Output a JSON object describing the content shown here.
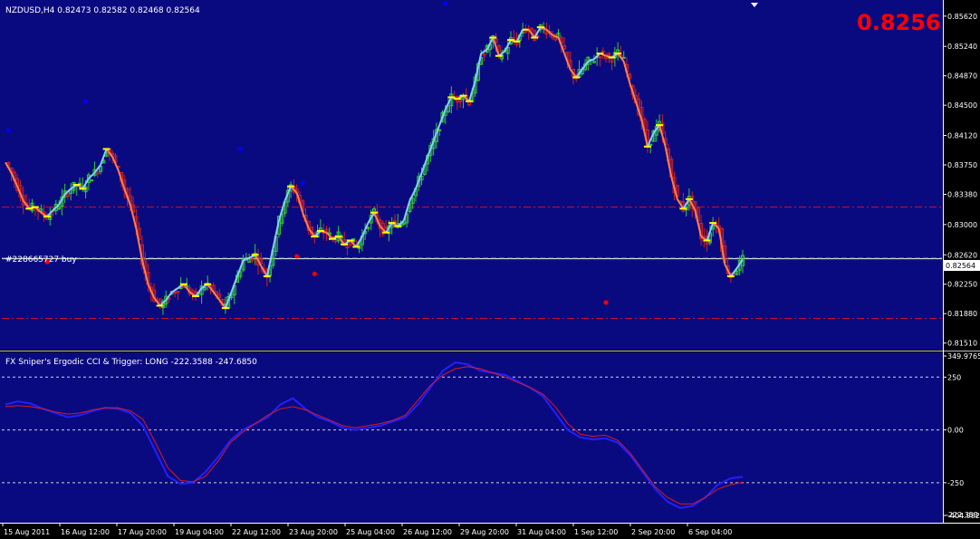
{
  "window": {
    "info_line": "NZDUSD,H4  0.82473 0.82582 0.82468 0.82564",
    "big_price": "0.8256",
    "order_label": "#228665727 buy",
    "bg_color": "#0a0a80",
    "grid_color": "#ffffff"
  },
  "chart_data": [
    {
      "type": "candlestick",
      "title": "NZDUSD,H4",
      "ohlc_last": {
        "open": 0.82473,
        "high": 0.82582,
        "low": 0.82468,
        "close": 0.82564
      },
      "y_ticks": [
        "0.85620",
        "0.85240",
        "0.84870",
        "0.84500",
        "0.84120",
        "0.83750",
        "0.83380",
        "0.83000",
        "0.82620",
        "0.82250",
        "0.81880",
        "0.81510"
      ],
      "y_tick_values": [
        0.8562,
        0.8524,
        0.8487,
        0.845,
        0.8412,
        0.8375,
        0.8338,
        0.83,
        0.8262,
        0.8225,
        0.8188,
        0.8151
      ],
      "ylim": [
        0.8145,
        0.858
      ],
      "current_price_label": "0.82564",
      "current_price": 0.82564,
      "horizontal_lines": [
        {
          "name": "order-line",
          "value": 0.8257,
          "style": "solid",
          "color": "#ffffff"
        },
        {
          "name": "upper-level",
          "value": 0.8322,
          "style": "dashdot",
          "color": "#c8102e"
        },
        {
          "name": "lower-level",
          "value": 0.8182,
          "style": "dashdot",
          "color": "#c8102e"
        },
        {
          "name": "bid-line",
          "value": 0.8258,
          "style": "dashed",
          "color": "#2e8b57"
        }
      ],
      "closes": [
        0.8378,
        0.8365,
        0.8348,
        0.833,
        0.832,
        0.8322,
        0.8315,
        0.831,
        0.8318,
        0.8325,
        0.8338,
        0.8345,
        0.835,
        0.8345,
        0.8358,
        0.8365,
        0.8375,
        0.8395,
        0.8385,
        0.8368,
        0.8345,
        0.8325,
        0.8295,
        0.8255,
        0.8225,
        0.8208,
        0.8198,
        0.8205,
        0.8215,
        0.822,
        0.8225,
        0.8215,
        0.821,
        0.822,
        0.8225,
        0.8215,
        0.8205,
        0.8195,
        0.8215,
        0.8235,
        0.8255,
        0.8258,
        0.8262,
        0.8248,
        0.8235,
        0.827,
        0.8305,
        0.833,
        0.8348,
        0.834,
        0.8315,
        0.8295,
        0.8285,
        0.8292,
        0.829,
        0.8282,
        0.8285,
        0.8275,
        0.828,
        0.8272,
        0.8285,
        0.8302,
        0.8315,
        0.8298,
        0.829,
        0.8302,
        0.8298,
        0.8305,
        0.833,
        0.8345,
        0.8365,
        0.8385,
        0.8405,
        0.8425,
        0.8445,
        0.846,
        0.8458,
        0.8462,
        0.8455,
        0.848,
        0.8515,
        0.852,
        0.8535,
        0.8512,
        0.8518,
        0.8532,
        0.853,
        0.8545,
        0.8545,
        0.8535,
        0.8548,
        0.8545,
        0.8538,
        0.8535,
        0.8515,
        0.8495,
        0.8485,
        0.8495,
        0.8505,
        0.8508,
        0.8515,
        0.8512,
        0.851,
        0.8515,
        0.8505,
        0.8478,
        0.8455,
        0.8432,
        0.8398,
        0.8415,
        0.8425,
        0.8398,
        0.836,
        0.8332,
        0.832,
        0.8332,
        0.8318,
        0.8285,
        0.828,
        0.8302,
        0.8295,
        0.825,
        0.8235,
        0.8245,
        0.8256
      ],
      "markers": [
        {
          "x_index": 1,
          "value": 0.8418,
          "color": "#0000ff"
        },
        {
          "x_index": 27,
          "value": 0.8455,
          "color": "#0000ff"
        },
        {
          "x_index": 79,
          "value": 0.8395,
          "color": "#0000ff"
        },
        {
          "x_index": 100,
          "value": 0.8352,
          "color": "#0000ff"
        },
        {
          "x_index": 148,
          "value": 0.8578,
          "color": "#0000ff"
        },
        {
          "x_index": 14,
          "value": 0.8253,
          "color": "#ff0000"
        },
        {
          "x_index": 98,
          "value": 0.826,
          "color": "#ff0000"
        },
        {
          "x_index": 104,
          "value": 0.8238,
          "color": "#ff0000"
        },
        {
          "x_index": 202,
          "value": 0.8202,
          "color": "#ff0000"
        }
      ]
    },
    {
      "type": "line",
      "title": "FX Sniper's Ergodic CCI & Trigger: LONG -222.3588 -247.6850",
      "y_ticks": [
        "349.9765",
        "250",
        "0.00",
        "-250",
        "-404.982"
      ],
      "y_tick_values": [
        349.9765,
        250,
        0,
        -250,
        -404.982
      ],
      "ylim": [
        -404.982,
        349.9765
      ],
      "current_label": "-222.359",
      "series": [
        {
          "name": "Ergodic CCI",
          "color": "#2020ff",
          "values": [
            120,
            135,
            125,
            100,
            80,
            60,
            70,
            90,
            105,
            100,
            80,
            20,
            -100,
            -220,
            -255,
            -250,
            -200,
            -130,
            -50,
            0,
            30,
            60,
            120,
            150,
            100,
            60,
            40,
            10,
            0,
            10,
            20,
            40,
            60,
            120,
            200,
            280,
            320,
            310,
            280,
            270,
            260,
            230,
            200,
            160,
            80,
            0,
            -35,
            -45,
            -40,
            -60,
            -120,
            -200,
            -280,
            -340,
            -370,
            -360,
            -320,
            -260,
            -230,
            -222.36
          ]
        },
        {
          "name": "Trigger",
          "color": "#e01818",
          "values": [
            110,
            115,
            110,
            100,
            85,
            75,
            80,
            95,
            105,
            105,
            90,
            50,
            -60,
            -180,
            -240,
            -245,
            -220,
            -150,
            -60,
            -10,
            30,
            70,
            100,
            110,
            95,
            70,
            45,
            20,
            10,
            20,
            30,
            45,
            70,
            140,
            210,
            260,
            290,
            300,
            290,
            270,
            250,
            225,
            200,
            170,
            110,
            30,
            -20,
            -30,
            -25,
            -50,
            -110,
            -190,
            -270,
            -320,
            -350,
            -350,
            -320,
            -280,
            -260,
            -247.69
          ]
        }
      ]
    }
  ],
  "x_axis_labels": [
    "15 Aug 2011",
    "16 Aug 12:00",
    "17 Aug 20:00",
    "19 Aug 04:00",
    "22 Aug 12:00",
    "23 Aug 20:00",
    "25 Aug 04:00",
    "26 Aug 12:00",
    "29 Aug 20:00",
    "31 Aug 04:00",
    "1 Sep 12:00",
    "2 Sep 20:00",
    "6 Sep 04:00"
  ]
}
